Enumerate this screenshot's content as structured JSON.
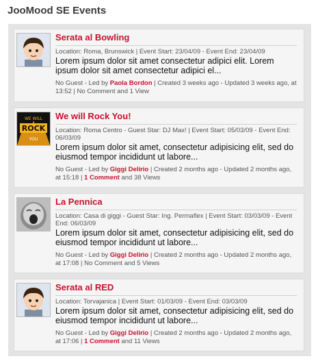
{
  "widget": {
    "title": "JooMood SE Events"
  },
  "events": [
    {
      "title": "Serata al Bowling",
      "avatar_icon": "cartoon-boy-avatar-icon",
      "meta": "Location: Roma, Brunswick | Event Start: 23/04/09 - Event End: 23/04/09",
      "desc": "Lorem ipsum dolor sit amet consectetur adipici elit. Lorem ipsum dolor sit amet consectetur adipici el...",
      "guest": "No Guest",
      "led_prefix": " - Led by ",
      "leader": "Paola Bordon",
      "created_updated": " | Created 3 weeks ago - Updated 3 weeks ago, at 13:52 | ",
      "comments": "No Comment",
      "comments_link": false,
      "views": " and 1 View"
    },
    {
      "title": "We will Rock You!",
      "avatar_icon": "we-will-rock-you-poster-icon",
      "meta": "Location: Roma Centro - Guest Star: DJ Max! | Event Start: 05/03/09 - Event End: 06/03/09",
      "desc": "Lorem ipsum dolor sit amet, consectetur adipisicing elit, sed do eiusmod tempor incididunt ut labore...",
      "guest": "No Guest",
      "led_prefix": " - Led by ",
      "leader": "Giggi Delirio",
      "created_updated": " | Created 2 months ago - Updated 2 months ago, at 15:18 | ",
      "comments": "1 Comment",
      "comments_link": true,
      "views": " and 38 Views"
    },
    {
      "title": "La Pennica",
      "avatar_icon": "yawning-baby-photo-icon",
      "meta": "Location: Casa di giggi - Guest Star: Ing. Permaflex | Event Start: 03/03/09 - Event End: 06/03/09",
      "desc": "Lorem ipsum dolor sit amet, consectetur adipisicing elit, sed do eiusmod tempor incididunt ut labore...",
      "guest": "No Guest",
      "led_prefix": " - Led by ",
      "leader": "Giggi Delirio",
      "created_updated": " | Created 2 months ago - Updated 2 months ago, at 17:08 | ",
      "comments": "No Comment",
      "comments_link": false,
      "views": " and 5 Views"
    },
    {
      "title": "Serata al RED",
      "avatar_icon": "cartoon-boy-avatar-icon",
      "meta": "Location: Torvajanica | Event Start: 01/03/09 - Event End: 03/03/09",
      "desc": "Lorem ipsum dolor sit amet, consectetur adipisicing elit, sed do eiusmod tempor incididunt ut labore...",
      "guest": "No Guest",
      "led_prefix": " - Led by ",
      "leader": "Giggi Delirio",
      "created_updated": " | Created 2 months ago - Updated 2 months ago, at 17:06 | ",
      "comments": "1 Comment",
      "comments_link": true,
      "views": " and 11 Views"
    }
  ],
  "colors": {
    "accent": "#c8102e",
    "panel": "#e4e4e4",
    "card": "#f5f5f5"
  }
}
